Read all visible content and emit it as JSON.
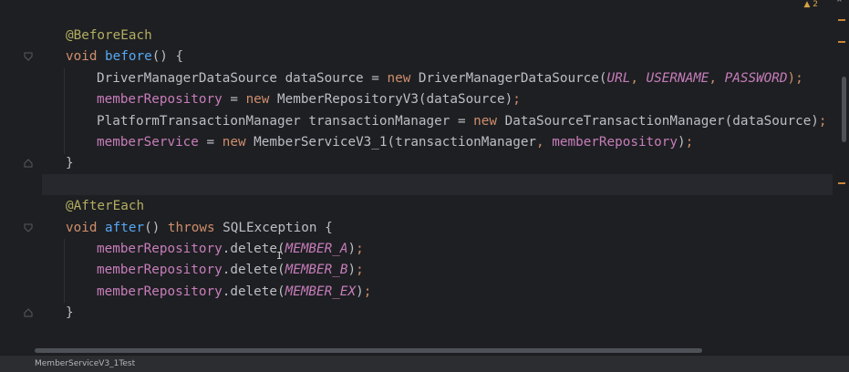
{
  "editor": {
    "warnings": {
      "icon": "warning-icon",
      "count": "2",
      "color": "#d9a343"
    },
    "chevron": "⌃",
    "lines": [
      [
        {
          "t": "@BeforeEach",
          "c": "ann"
        }
      ],
      [
        {
          "t": "void",
          "c": "kw"
        },
        {
          "t": " ",
          "c": "plain"
        },
        {
          "t": "before",
          "c": "fn"
        },
        {
          "t": "() {",
          "c": "plain"
        }
      ],
      [
        {
          "t": "DriverManagerDataSource dataSource = ",
          "c": "plain"
        },
        {
          "t": "new",
          "c": "kw"
        },
        {
          "t": " DriverManagerDataSource(",
          "c": "plain"
        },
        {
          "t": "URL",
          "c": "const"
        },
        {
          "t": ", ",
          "c": "kw"
        },
        {
          "t": "USERNAME",
          "c": "const"
        },
        {
          "t": ", ",
          "c": "kw"
        },
        {
          "t": "PASSWORD",
          "c": "const"
        },
        {
          "t": ");",
          "c": "kw"
        }
      ],
      [
        {
          "t": "memberRepository",
          "c": "fld"
        },
        {
          "t": " = ",
          "c": "plain"
        },
        {
          "t": "new",
          "c": "kw"
        },
        {
          "t": " MemberRepositoryV3(dataSource)",
          "c": "plain"
        },
        {
          "t": ";",
          "c": "kw"
        }
      ],
      [
        {
          "t": "PlatformTransactionManager transactionManager = ",
          "c": "plain"
        },
        {
          "t": "new",
          "c": "kw"
        },
        {
          "t": " DataSourceTransactionManager(dataSource)",
          "c": "plain"
        },
        {
          "t": ";",
          "c": "kw"
        }
      ],
      [
        {
          "t": "memberService",
          "c": "fld"
        },
        {
          "t": " = ",
          "c": "plain"
        },
        {
          "t": "new",
          "c": "kw"
        },
        {
          "t": " MemberServiceV3_1(transactionManager",
          "c": "plain"
        },
        {
          "t": ", ",
          "c": "kw"
        },
        {
          "t": "memberRepository",
          "c": "fld"
        },
        {
          "t": ")",
          "c": "plain"
        },
        {
          "t": ";",
          "c": "kw"
        }
      ],
      [
        {
          "t": "}",
          "c": "plain"
        }
      ],
      [
        {
          "t": "",
          "c": "plain"
        }
      ],
      [
        {
          "t": "@AfterEach",
          "c": "ann"
        }
      ],
      [
        {
          "t": "void",
          "c": "kw"
        },
        {
          "t": " ",
          "c": "plain"
        },
        {
          "t": "after",
          "c": "fn"
        },
        {
          "t": "() ",
          "c": "plain"
        },
        {
          "t": "throws",
          "c": "kw"
        },
        {
          "t": " SQLException {",
          "c": "plain"
        }
      ],
      [
        {
          "t": "memberRepository",
          "c": "fld"
        },
        {
          "t": ".delete(",
          "c": "plain"
        },
        {
          "t": "MEMBER_A",
          "c": "const"
        },
        {
          "t": ")",
          "c": "plain"
        },
        {
          "t": ";",
          "c": "kw"
        }
      ],
      [
        {
          "t": "memberRepository",
          "c": "fld"
        },
        {
          "t": ".delete(",
          "c": "plain"
        },
        {
          "t": "MEMBER_B",
          "c": "const"
        },
        {
          "t": ")",
          "c": "plain"
        },
        {
          "t": ";",
          "c": "kw"
        }
      ],
      [
        {
          "t": "memberRepository",
          "c": "fld"
        },
        {
          "t": ".delete(",
          "c": "plain"
        },
        {
          "t": "MEMBER_EX",
          "c": "const"
        },
        {
          "t": ")",
          "c": "plain"
        },
        {
          "t": ";",
          "c": "kw"
        }
      ],
      [
        {
          "t": "}",
          "c": "plain"
        }
      ]
    ],
    "indented": [
      2,
      3,
      4,
      5,
      10,
      11,
      12
    ]
  },
  "status": {
    "file_name": "MemberServiceV3_1Test"
  }
}
